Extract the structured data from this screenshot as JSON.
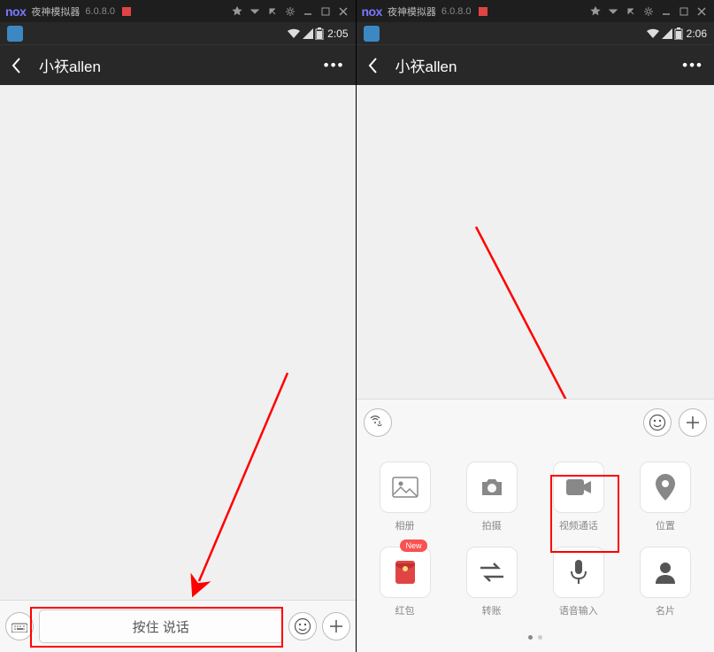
{
  "nox": {
    "logo": "nox",
    "title": "夜神模拟器",
    "version": "6.0.8.0"
  },
  "status": {
    "time_left": "2:05",
    "time_right": "2:06"
  },
  "chat": {
    "name": "小祆allen",
    "voice_hint": "按住 说话"
  },
  "attach": {
    "row1": [
      {
        "label": "相册"
      },
      {
        "label": "拍摄"
      },
      {
        "label": "视频通话"
      },
      {
        "label": "位置"
      }
    ],
    "row2": [
      {
        "label": "红包",
        "badge": "New"
      },
      {
        "label": "转账"
      },
      {
        "label": "语音输入"
      },
      {
        "label": "名片"
      }
    ]
  }
}
